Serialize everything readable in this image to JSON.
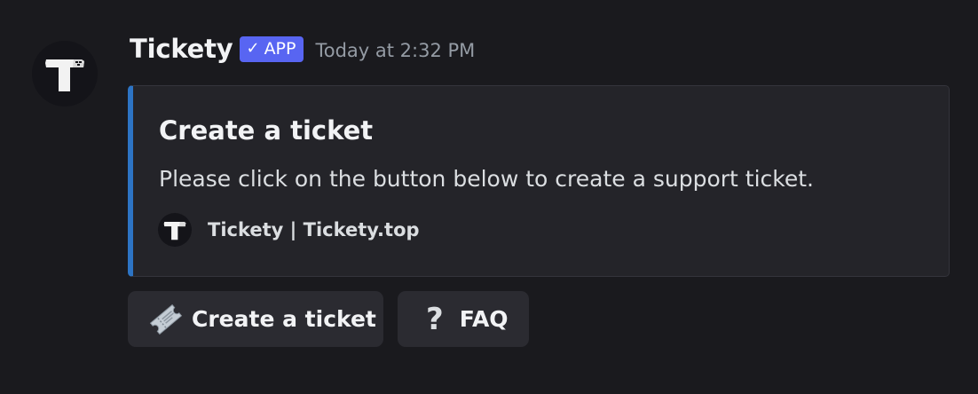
{
  "message": {
    "author": "Tickety",
    "badge": {
      "check_icon": "✓",
      "label": "APP"
    },
    "timestamp": "Today at 2:32 PM",
    "avatar_icon": "tickety-logo-icon"
  },
  "embed": {
    "accent_color": "#2d74c4",
    "title": "Create a ticket",
    "description": "Please click on the button below to create a support ticket.",
    "footer": {
      "icon": "tickety-logo-icon",
      "text": "Tickety | Tickety.top"
    }
  },
  "buttons": [
    {
      "icon": "ticket-icon",
      "label": "Create a ticket"
    },
    {
      "icon": "question-mark-icon",
      "icon_glyph": "?",
      "label": "FAQ"
    }
  ],
  "colors": {
    "background": "#1a1a1e",
    "embed_background": "#242429",
    "badge": "#5865f2",
    "button": "#2b2b31"
  }
}
